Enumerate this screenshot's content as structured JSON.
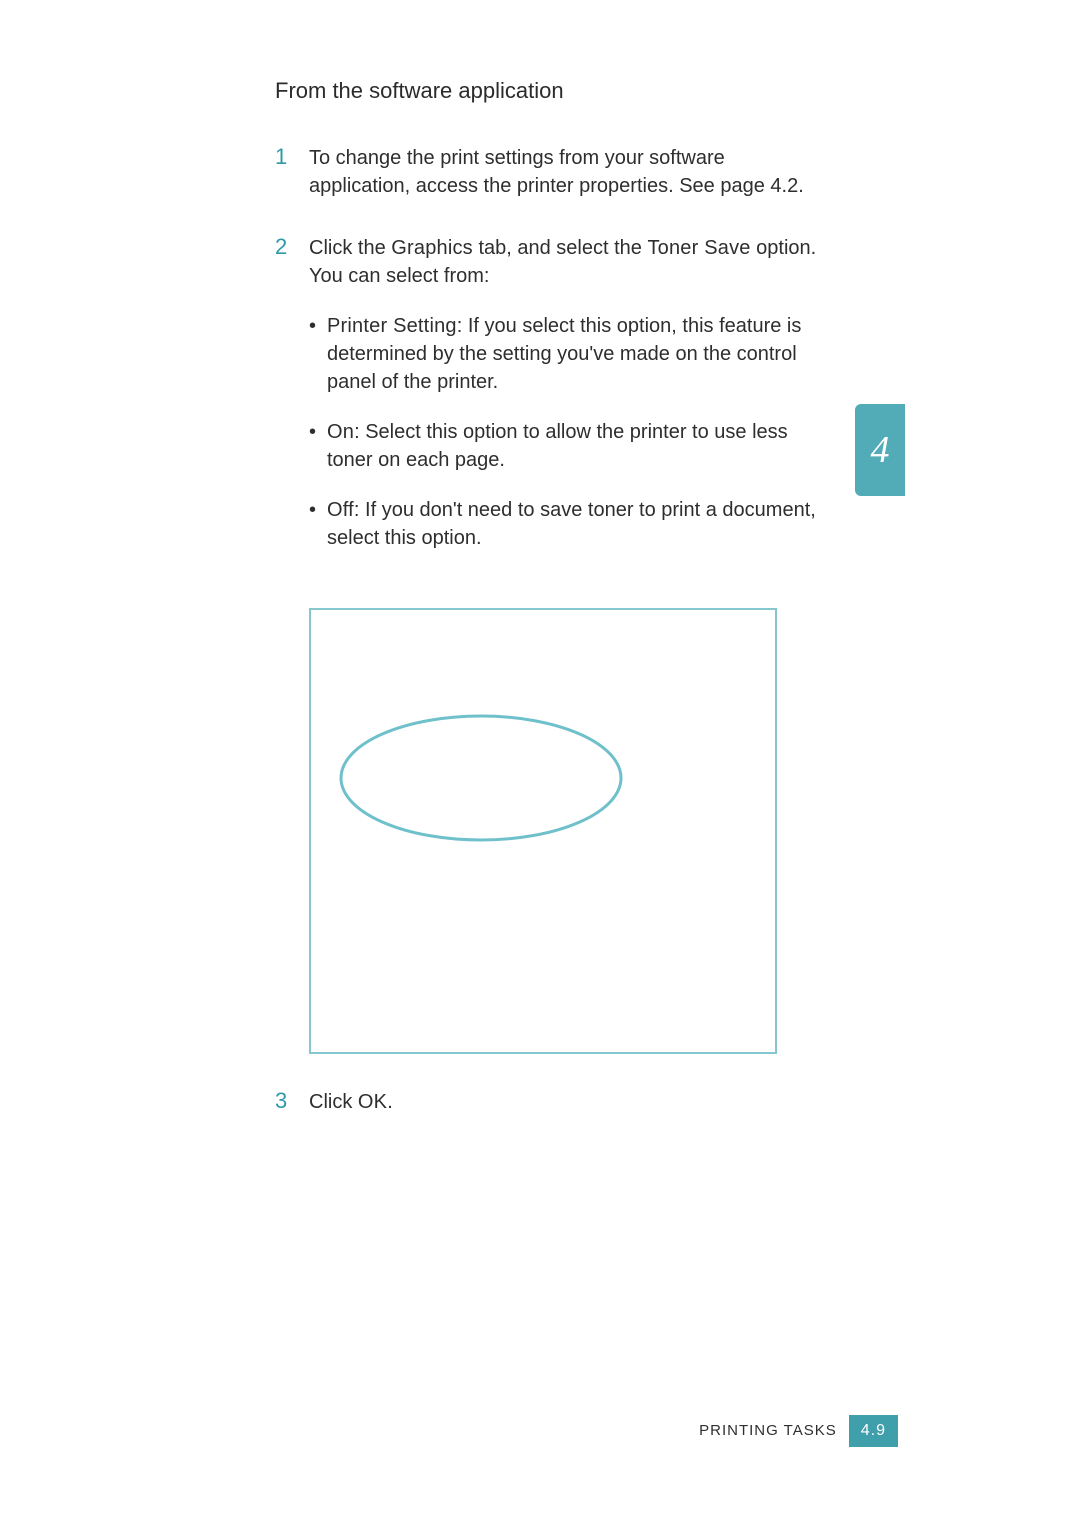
{
  "heading": "From the software application",
  "steps": {
    "1": {
      "num": "1",
      "text": "To change the print settings from your software application, access the printer properties. See page 4.2."
    },
    "2": {
      "num": "2",
      "intro_a": "Click the ",
      "graphics": "Graphics",
      "intro_b": " tab, and select the ",
      "toner_save": "Toner Save",
      "intro_c": " option. You can select from:",
      "bullets": {
        "ps": {
          "term": "Printer Setting",
          "rest": ": If you select this option, this feature is determined by the setting you've made on the control panel of the printer."
        },
        "on": {
          "term": "On",
          "rest": ": Select this option to allow the printer to use less toner on each page."
        },
        "off": {
          "term": "Off",
          "rest": ": If you don't need to save toner to print a document, select this option."
        }
      }
    },
    "3": {
      "num": "3",
      "pre": "Click ",
      "ok": "OK",
      "post": "."
    }
  },
  "chapter_tab": "4",
  "footer": {
    "label": "PRINTING TASKS",
    "page": "4.9"
  }
}
